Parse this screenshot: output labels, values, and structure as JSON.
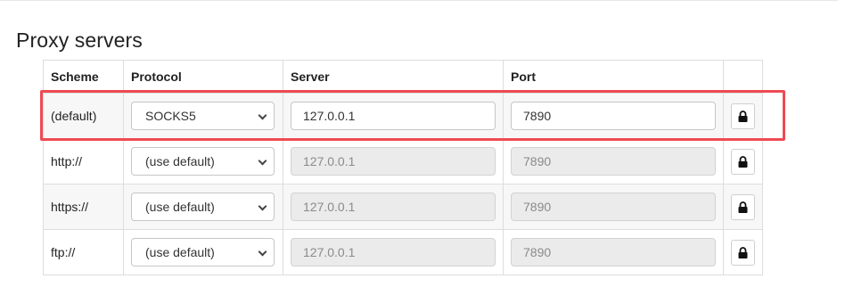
{
  "title": "Proxy servers",
  "columns": [
    "Scheme",
    "Protocol",
    "Server",
    "Port",
    ""
  ],
  "rows": [
    {
      "scheme": "(default)",
      "protocol": "SOCKS5",
      "server": "127.0.0.1",
      "port": "7890",
      "server_disabled": false,
      "lock_icon": "lock-icon"
    },
    {
      "scheme": "http://",
      "protocol": "(use default)",
      "server": "127.0.0.1",
      "port": "7890",
      "server_disabled": true,
      "lock_icon": "lock-icon"
    },
    {
      "scheme": "https://",
      "protocol": "(use default)",
      "server": "127.0.0.1",
      "port": "7890",
      "server_disabled": true,
      "lock_icon": "lock-icon"
    },
    {
      "scheme": "ftp://",
      "protocol": "(use default)",
      "server": "127.0.0.1",
      "port": "7890",
      "server_disabled": true,
      "lock_icon": "lock-icon"
    }
  ],
  "colors": {
    "highlight": "#ee4a53",
    "disabled_field": "#ebebeb",
    "row_stripe": "#f7f7f7",
    "border": "#dddddd"
  }
}
